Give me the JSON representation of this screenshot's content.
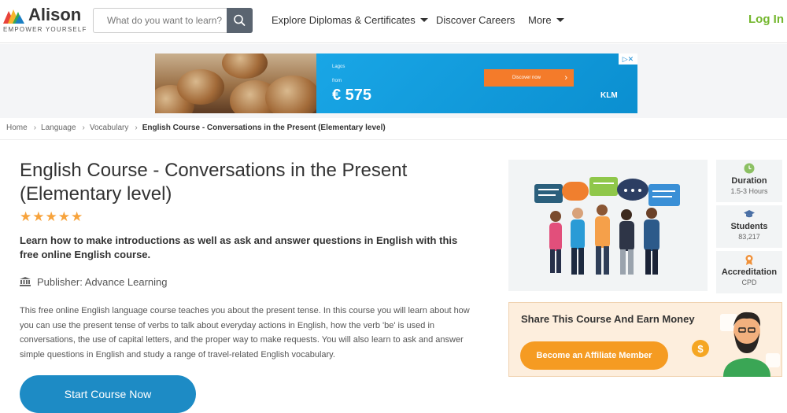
{
  "header": {
    "logo_name": "Alison",
    "logo_tagline": "EMPOWER YOURSELF",
    "search_placeholder": "What do you want to learn?",
    "nav": {
      "explore": "Explore Diplomas & Certificates",
      "careers": "Discover Careers",
      "more": "More"
    },
    "login": "Log In",
    "colors": {
      "accent": "#74b72e",
      "search_button": "#5a6470"
    }
  },
  "ad": {
    "city": "Lagos",
    "from_label": "from",
    "price": "€ 575",
    "cta": "Discover now",
    "brand": "KLM",
    "colors": {
      "background": "#0b95d8",
      "cta": "#f47b2a"
    }
  },
  "breadcrumb": {
    "items": [
      "Home",
      "Language",
      "Vocabulary"
    ],
    "current": "English Course - Conversations in the Present (Elementary level)"
  },
  "course": {
    "title_line1": "English Course - Conversations in the Present",
    "title_line2": "(Elementary level)",
    "rating_stars": 5,
    "stars_text": "★★★★★",
    "subtitle": "Learn how to make introductions as well as ask and answer questions in English with this free online English course.",
    "publisher": "Publisher: Advance Learning",
    "description": "This free online English language course teaches you about the present tense. In this course you will learn about how you can use the present tense of verbs to talk about everyday actions in English, how the verb 'be' is used in conversations, the use of capital letters, and the proper way to make requests. You will also learn to ask and answer simple questions in English and study a range of travel-related English vocabulary.",
    "start_button": "Start Course Now",
    "colors": {
      "start_button": "#1d8bc5",
      "stars": "#f7a33c"
    }
  },
  "stats": [
    {
      "label": "Duration",
      "value": "1.5-3 Hours",
      "icon": "clock-icon"
    },
    {
      "label": "Students",
      "value": "83,217",
      "icon": "graduation-cap-icon"
    },
    {
      "label": "Accreditation",
      "value": "CPD",
      "icon": "award-icon"
    }
  ],
  "affiliate": {
    "title": "Share This Course And Earn Money",
    "button": "Become an Affiliate Member",
    "colors": {
      "background": "#fdeedd",
      "button": "#f59b22"
    }
  }
}
